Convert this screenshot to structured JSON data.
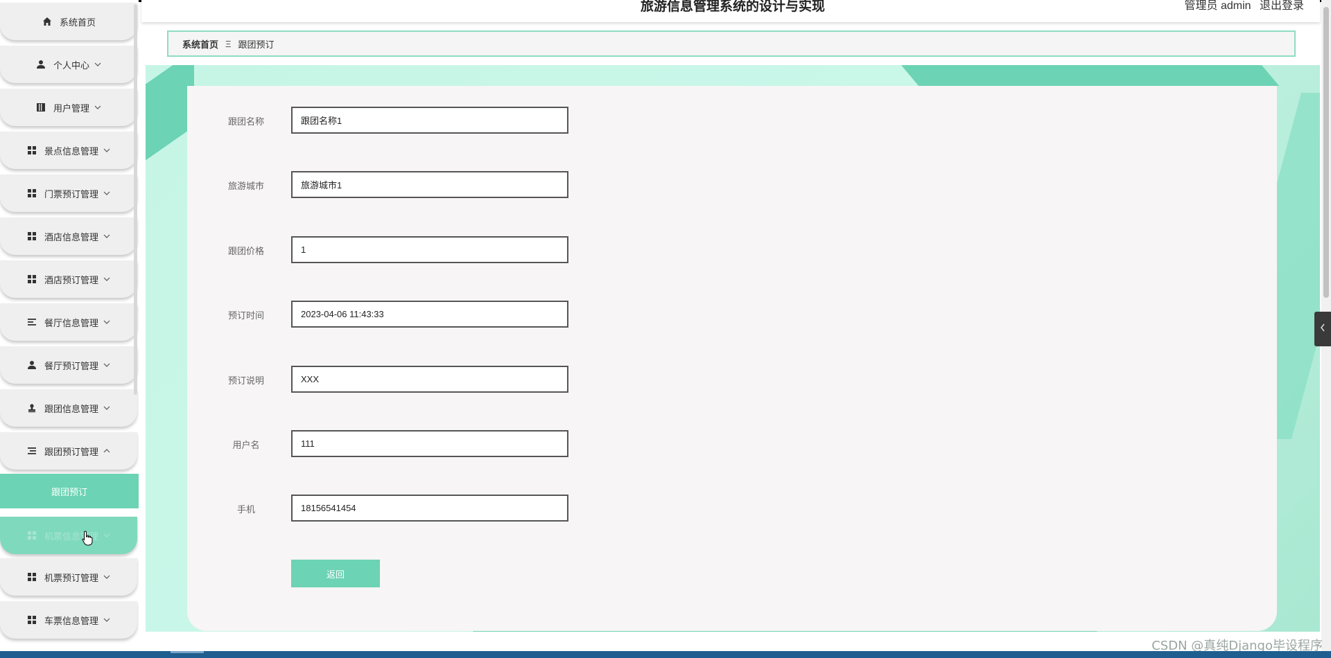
{
  "header": {
    "app_title": "旅游信息管理系统的设计与实现",
    "user_label": "管理员 admin",
    "logout_label": "退出登录"
  },
  "breadcrumb": {
    "home": "系统首页",
    "separator": "Ξ",
    "current": "跟团预订"
  },
  "sidebar": {
    "items": [
      {
        "label": "系统首页",
        "icon": "home-icon"
      },
      {
        "label": "个人中心",
        "icon": "person-icon"
      },
      {
        "label": "用户管理",
        "icon": "book-icon"
      },
      {
        "label": "景点信息管理",
        "icon": "grid-icon"
      },
      {
        "label": "门票预订管理",
        "icon": "grid-icon"
      },
      {
        "label": "酒店信息管理",
        "icon": "grid-icon"
      },
      {
        "label": "酒店预订管理",
        "icon": "grid-icon"
      },
      {
        "label": "餐厅信息管理",
        "icon": "list-icon"
      },
      {
        "label": "餐厅预订管理",
        "icon": "person-icon"
      },
      {
        "label": "跟团信息管理",
        "icon": "stamp-icon"
      },
      {
        "label": "跟团预订管理",
        "icon": "list-icon"
      },
      {
        "label": "机票信息管理",
        "icon": "grid-icon"
      },
      {
        "label": "机票预订管理",
        "icon": "grid-icon"
      },
      {
        "label": "车票信息管理",
        "icon": "grid-icon"
      }
    ],
    "active_submenu": "跟团预订"
  },
  "form": {
    "fields": [
      {
        "label": "跟团名称",
        "value": "跟团名称1"
      },
      {
        "label": "旅游城市",
        "value": "旅游城市1"
      },
      {
        "label": "跟团价格",
        "value": "1"
      },
      {
        "label": "预订时间",
        "value": "2023-04-06 11:43:33"
      },
      {
        "label": "预订说明",
        "value": "XXX"
      },
      {
        "label": "用户名",
        "value": "111"
      },
      {
        "label": "手机",
        "value": "18156541454"
      }
    ],
    "back_label": "返回"
  },
  "watermark": "CSDN @真纯Django毕设程序",
  "colors": {
    "accent": "#6cd3b4",
    "accent_light": "#c6f5e6",
    "card": "#f7f5f5",
    "selection": "#1e88e5"
  }
}
